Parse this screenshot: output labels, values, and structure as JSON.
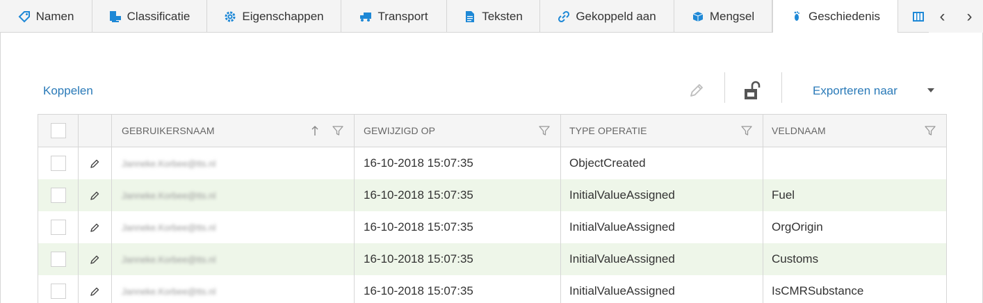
{
  "tabs": [
    {
      "label": "Namen",
      "icon": "tag-icon"
    },
    {
      "label": "Classificatie",
      "icon": "classification-icon"
    },
    {
      "label": "Eigenschappen",
      "icon": "gear-icon"
    },
    {
      "label": "Transport",
      "icon": "truck-icon"
    },
    {
      "label": "Teksten",
      "icon": "document-icon"
    },
    {
      "label": "Gekoppeld aan",
      "icon": "link-icon"
    },
    {
      "label": "Mengsel",
      "icon": "cubes-icon"
    },
    {
      "label": "Geschiedenis",
      "icon": "footprint-icon",
      "active": true
    },
    {
      "label": "",
      "icon": "columns-icon"
    }
  ],
  "nav": {
    "prev": "‹",
    "next": "›"
  },
  "toolbar": {
    "link_label": "Koppelen",
    "edit_icon": "pencil-icon",
    "unlock_icon": "unlock-icon",
    "export_label": "Exporteren naar"
  },
  "grid": {
    "columns": {
      "user": "GEBRUIKERSNAAM",
      "date": "GEWIJZIGD OP",
      "type": "TYPE OPERATIE",
      "field": "VELDNAAM"
    },
    "sort": {
      "column": "user",
      "direction": "ascending"
    },
    "rows": [
      {
        "user": "Janneke.Korbee@tts.nl",
        "date": "16-10-2018 15:07:35",
        "type": "ObjectCreated",
        "field": ""
      },
      {
        "user": "Janneke.Korbee@tts.nl",
        "date": "16-10-2018 15:07:35",
        "type": "InitialValueAssigned",
        "field": "Fuel"
      },
      {
        "user": "Janneke.Korbee@tts.nl",
        "date": "16-10-2018 15:07:35",
        "type": "InitialValueAssigned",
        "field": "OrgOrigin"
      },
      {
        "user": "Janneke.Korbee@tts.nl",
        "date": "16-10-2018 15:07:35",
        "type": "InitialValueAssigned",
        "field": "Customs"
      },
      {
        "user": "Janneke.Korbee@tts.nl",
        "date": "16-10-2018 15:07:35",
        "type": "InitialValueAssigned",
        "field": "IsCMRSubstance"
      }
    ]
  },
  "colors": {
    "accent": "#2a7ab8",
    "alt_row": "#eef6e9",
    "icon_blue": "#1e88d6"
  }
}
